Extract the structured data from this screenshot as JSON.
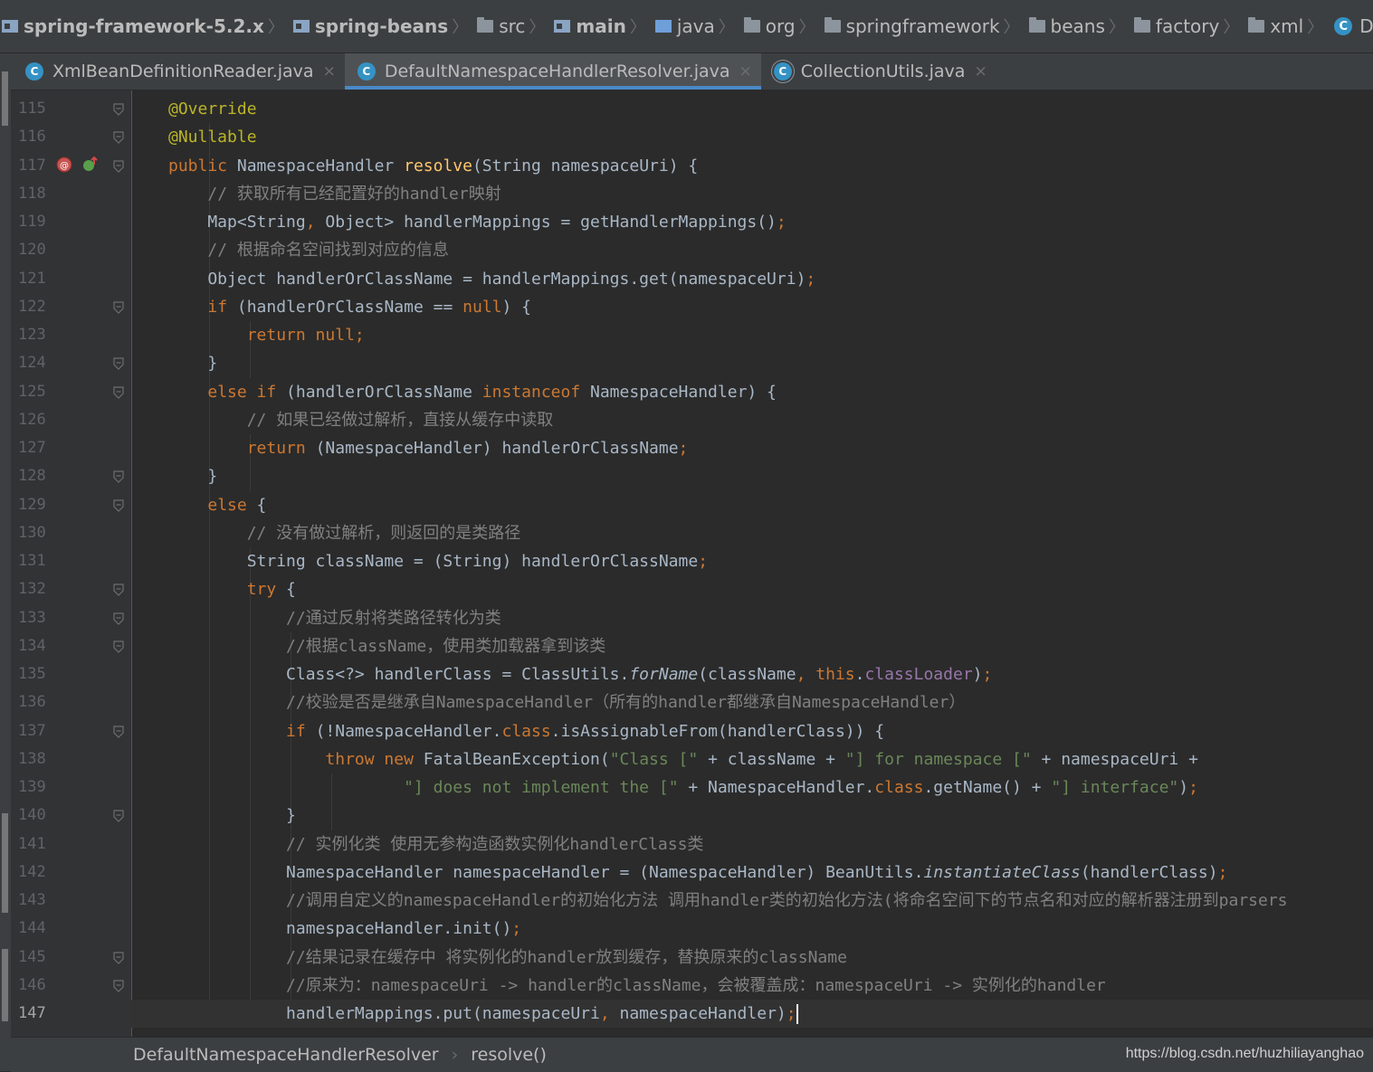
{
  "breadcrumb": {
    "items": [
      {
        "label": "spring-framework-5.2.x",
        "icon": "module-icon",
        "bold": true
      },
      {
        "label": "spring-beans",
        "icon": "module-icon",
        "bold": true
      },
      {
        "label": "src",
        "icon": "folder-icon",
        "bold": false
      },
      {
        "label": "main",
        "icon": "module-folder-icon",
        "bold": true
      },
      {
        "label": "java",
        "icon": "source-folder-icon",
        "bold": false
      },
      {
        "label": "org",
        "icon": "package-icon",
        "bold": false
      },
      {
        "label": "springframework",
        "icon": "package-icon",
        "bold": false
      },
      {
        "label": "beans",
        "icon": "package-icon",
        "bold": false
      },
      {
        "label": "factory",
        "icon": "package-icon",
        "bold": false
      },
      {
        "label": "xml",
        "icon": "package-icon",
        "bold": false
      },
      {
        "label": "DefaultNamespaceHan",
        "icon": "class-icon",
        "bold": false
      }
    ]
  },
  "tabs": [
    {
      "label": "XmlBeanDefinitionReader.java",
      "active": false,
      "icon": "class-icon"
    },
    {
      "label": "DefaultNamespaceHandlerResolver.java",
      "active": true,
      "icon": "class-icon"
    },
    {
      "label": "CollectionUtils.java",
      "active": false,
      "icon": "library-class-icon"
    }
  ],
  "editor": {
    "current_line": 147,
    "lines": [
      {
        "n": "115",
        "html": "<span class=\"ann\">@Override</span>"
      },
      {
        "n": "116",
        "html": "<span class=\"ann\">@Nullable</span>"
      },
      {
        "n": "117",
        "html": "<span class=\"kw\">public</span> NamespaceHandler <span class=\"fn\">resolve</span>(String namespaceUri) {"
      },
      {
        "n": "118",
        "html": "    <span class=\"cm\">// 获取所有已经配置好的handler映射</span>"
      },
      {
        "n": "119",
        "html": "    Map&lt;String<span class=\"kw\">,</span> Object&gt; handlerMappings = getHandlerMappings()<span class=\"kw\">;</span>"
      },
      {
        "n": "120",
        "html": "    <span class=\"cm\">// 根据命名空间找到对应的信息</span>"
      },
      {
        "n": "121",
        "html": "    Object handlerOrClassName = handlerMappings.get(namespaceUri)<span class=\"kw\">;</span>"
      },
      {
        "n": "122",
        "html": "    <span class=\"kw\">if</span> (handlerOrClassName == <span class=\"kw\">null</span>) {"
      },
      {
        "n": "123",
        "html": "        <span class=\"kw\">return null;</span>"
      },
      {
        "n": "124",
        "html": "    }"
      },
      {
        "n": "125",
        "html": "    <span class=\"kw\">else if</span> (handlerOrClassName <span class=\"kw\">instanceof</span> NamespaceHandler) {"
      },
      {
        "n": "126",
        "html": "        <span class=\"cm\">// 如果已经做过解析，直接从缓存中读取</span>"
      },
      {
        "n": "127",
        "html": "        <span class=\"kw\">return</span> (NamespaceHandler) handlerOrClassName<span class=\"kw\">;</span>"
      },
      {
        "n": "128",
        "html": "    }"
      },
      {
        "n": "129",
        "html": "    <span class=\"kw\">else</span> {"
      },
      {
        "n": "130",
        "html": "        <span class=\"cm\">// 没有做过解析，则返回的是类路径</span>"
      },
      {
        "n": "131",
        "html": "        String className = (String) handlerOrClassName<span class=\"kw\">;</span>"
      },
      {
        "n": "132",
        "html": "        <span class=\"kw\">try</span> {"
      },
      {
        "n": "133",
        "html": "            <span class=\"cm\">//通过反射将类路径转化为类</span>"
      },
      {
        "n": "134",
        "html": "            <span class=\"cm\">//根据className，使用类加载器拿到该类</span>"
      },
      {
        "n": "135",
        "html": "            Class&lt;?&gt; handlerClass = ClassUtils.<span class=\"ital\">forName</span>(className<span class=\"kw\">, this</span>.<span class=\"fld\">classLoader</span>)<span class=\"kw\">;</span>"
      },
      {
        "n": "136",
        "html": "            <span class=\"cm\">//校验是否是继承自NamespaceHandler（所有的handler都继承自NamespaceHandler）</span>"
      },
      {
        "n": "137",
        "html": "            <span class=\"kw\">if</span> (!NamespaceHandler.<span class=\"kw\">class</span>.isAssignableFrom(handlerClass)) {"
      },
      {
        "n": "138",
        "html": "                <span class=\"kw\">throw new</span> FatalBeanException(<span class=\"str\">\"Class [\"</span> + className + <span class=\"str\">\"] for namespace [\"</span> + namespaceUri +"
      },
      {
        "n": "139",
        "html": "                        <span class=\"str\">\"] does not implement the [\"</span> + NamespaceHandler.<span class=\"kw\">class</span>.getName() + <span class=\"str\">\"] interface\"</span>)<span class=\"kw\">;</span>"
      },
      {
        "n": "140",
        "html": "            }"
      },
      {
        "n": "141",
        "html": "            <span class=\"cm\">// 实例化类 使用无参构造函数实例化handlerClass类</span>"
      },
      {
        "n": "142",
        "html": "            NamespaceHandler namespaceHandler = (NamespaceHandler) BeanUtils.<span class=\"ital\">instantiateClass</span>(handlerClass)<span class=\"kw\">;</span>"
      },
      {
        "n": "143",
        "html": "            <span class=\"cm\">//调用自定义的namespaceHandler的初始化方法 调用handler类的初始化方法(将命名空间下的节点名和对应的解析器注册到parsers</span>"
      },
      {
        "n": "144",
        "html": "            namespaceHandler.init()<span class=\"kw\">;</span>"
      },
      {
        "n": "145",
        "html": "            <span class=\"cm\">//结果记录在缓存中 将实例化的handler放到缓存，替换原来的className</span>"
      },
      {
        "n": "146",
        "html": "            <span class=\"cm\">//原来为：namespaceUri -&gt; handler的className，会被覆盖成：namespaceUri -&gt; 实例化的handler</span>"
      },
      {
        "n": "147",
        "html": "            handlerMappings.put(namespaceUri<span class=\"kw\">,</span> namespaceHandler)<span class=\"kw\">;</span><span class=\"caret\"></span>"
      }
    ],
    "folds": [
      "115",
      "116",
      "117",
      "122",
      "124",
      "125",
      "128",
      "129",
      "132",
      "133",
      "134",
      "137",
      "140",
      "145",
      "146"
    ]
  },
  "footer": {
    "class_name": "DefaultNamespaceHandlerResolver",
    "method_name": "resolve()"
  },
  "watermark": "https://blog.csdn.net/huzhiliayanghao",
  "colors": {
    "background": "#2b2b2b",
    "keyword": "#cc7832",
    "annotation": "#bbb529",
    "comment": "#808080",
    "string": "#6a8759",
    "method": "#ffc66d",
    "field": "#9876aa",
    "accent": "#4a88c7"
  }
}
